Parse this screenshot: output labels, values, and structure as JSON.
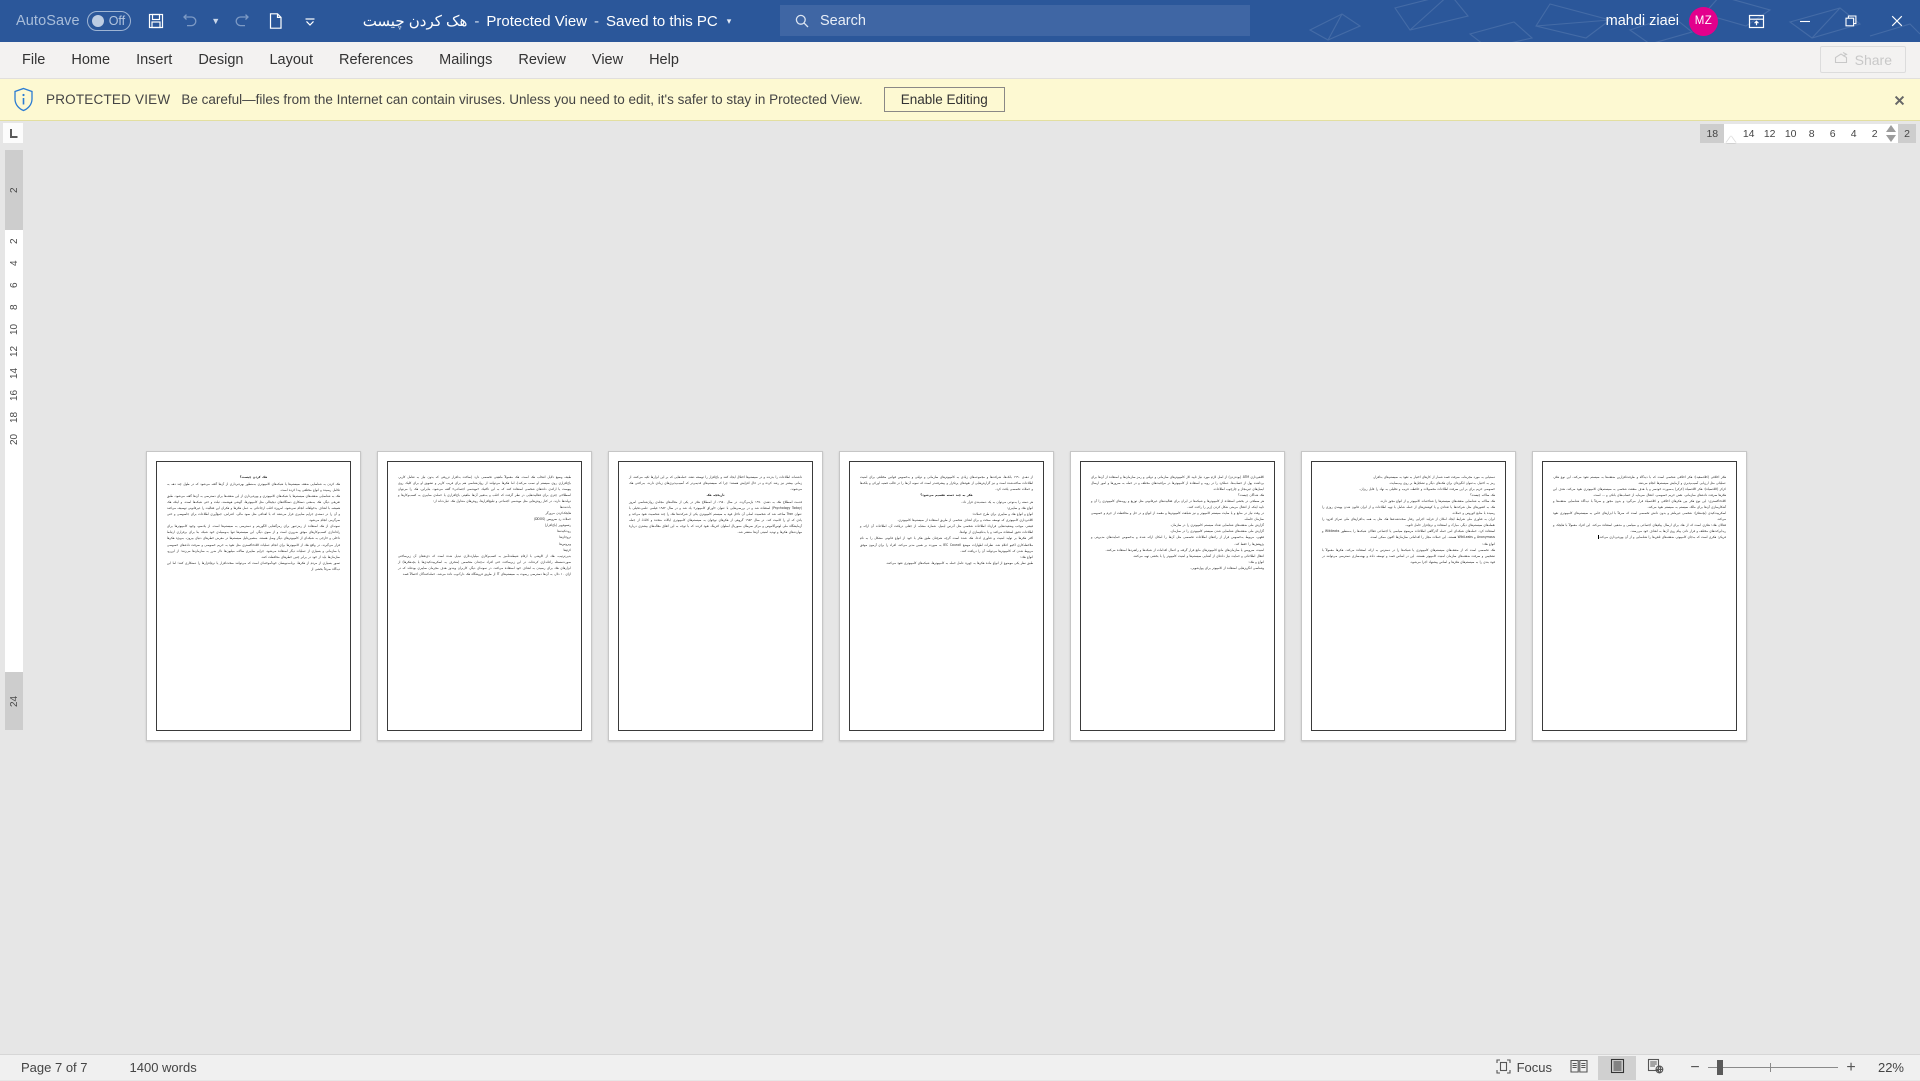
{
  "titlebar": {
    "autosave_label": "AutoSave",
    "autosave_state": "Off",
    "save_icon": "save-icon",
    "undo_icon": "undo-icon",
    "redo_icon": "redo-icon",
    "newdoc_icon": "document-icon",
    "customize_icon": "chevron-down-icon",
    "doc_name": "هک کردن چیست",
    "separator1": "-",
    "protected_view": "Protected View",
    "separator2": "-",
    "save_location": "Saved to this PC",
    "title_caret": "▾",
    "search_placeholder": "Search",
    "search_icon": "search-icon",
    "username": "mahdi ziaei",
    "avatar_initials": "MZ",
    "ribbon_display_icon": "ribbon-display-options-icon",
    "minimize_icon": "minimize-icon",
    "restore_icon": "restore-icon",
    "close_icon": "close-icon",
    "accent_color": "#2b579a",
    "avatar_color": "#e3008c"
  },
  "ribbon": {
    "tabs": [
      {
        "label": "File"
      },
      {
        "label": "Home"
      },
      {
        "label": "Insert"
      },
      {
        "label": "Design"
      },
      {
        "label": "Layout"
      },
      {
        "label": "References"
      },
      {
        "label": "Mailings"
      },
      {
        "label": "Review"
      },
      {
        "label": "View"
      },
      {
        "label": "Help"
      }
    ],
    "share_label": "Share",
    "share_icon": "share-icon",
    "share_disabled": true
  },
  "protected_view": {
    "icon": "info-shield-icon",
    "title": "PROTECTED VIEW",
    "message": "Be careful—files from the Internet can contain viruses. Unless you need to edit, it's safer to stay in Protected View.",
    "button_label": "Enable Editing",
    "close_icon": "close-icon",
    "background_color": "#fdf9d2"
  },
  "rulers": {
    "corner_icon": "left-tab-stop-icon",
    "horizontal_left_gray": "18",
    "horizontal_numbers": [
      "14",
      "12",
      "10",
      "8",
      "6",
      "4",
      "2"
    ],
    "horizontal_right_gray": "2",
    "vertical_top_gray": "2",
    "vertical_numbers": [
      "2",
      "4",
      "6",
      "8",
      "10",
      "12",
      "14",
      "16",
      "18",
      "20"
    ],
    "vertical_bottom_gray": "24"
  },
  "document": {
    "pages": [
      {
        "number": 1,
        "paragraphs": [
          {
            "style": "h",
            "text": "هک کردن چیست؟"
          },
          {
            "style": "p",
            "text": "هک کردن به شناسایی ضعف سیستم‌ها یا شبکه‌های کامپیوتری به‌منظور بهره‌برداری از آن‌ها گفته می‌شود که در طول چند دهه به تکامل رسیده و انواع مختلفی پیدا کرده است."
          },
          {
            "style": "p",
            "text": "هک به شناسایی ضعف‌های سیستم‌ها یا شبکه‌های کامپیوتری و بهره‌برداری از این ضعف‌ها برای دسترسی به آن‌ها گفته می‌شود. طبق تعریفی دیگر، هک به‌معنی دستکاری دستگاه‌های دیجیتالی مثل کامپیوترها، گوشی هوشمند، تبلت و حتی شبکه‌ها است. و اینکه هک همیشه با اهداف بدخواهانه انجام نمی‌شود، امروزه اغلب ارجاعاتی به عمل هکرها و هکران این فعالیت را غیرقانونی توصیف می‌کنند و آن را در دسته‌ی جرایم سایبری قرار می‌دهند که با اهدافی مثل سود مالی، اعتراض، جمع‌آوری اطلاعات برای جاسوسی و حتی سرگرمی انجام می‌شود."
          },
          {
            "style": "p",
            "text": "نمونه‌ای از هک استفاده از رمزعبور برای رمزگشایی الگوریتم و دسترسی به سیستم‌ها است. از یک‌سو، وجود کامپیوترها برای راه‌اندازی کسب‌وکارهای موفق ضروری است و از سوی دیگر، این سیستم‌ها تنها به‌وسیله‌ی خود شبکه بنا برای برقراری ارتباط داخلی و خارجی به شبکه‌ای از کامپیوترهای دیگر وصل هستند. به‌همین‌دلیل سیستم‌ها در معرض خطرهای دنیای بیرون، به‌ویژه هکرها قرار می‌گیرند. در واقع هک از کامپیوترها برای انجام عملیات کلاه‌خاکستری مثل نفوذ به حریم خصوصی و سرقت داده‌های خصوصی یا سازمانی و بسیاری از عملیات دیگر استفاده می‌شود. جرایم سایبری سالانه میلیون‌ها دلار ضرر به سازمان‌ها می‌زنند؛ از این‌رو، سازمان‌ها باید از خود در برابر چنین خطرهای محافظت کنند."
          },
          {
            "style": "p",
            "text": "تصور بسیاری از مردم از هکرها، برنامه‌نویسان خودآموخته‌ای است که می‌توانند سخت‌افزار یا نرم‌افزارها را دستکاری کنند؛ اما این دیدگاه صرفاً بخشی از"
          }
        ]
      },
      {
        "number": 2,
        "paragraphs": [
          {
            "style": "p",
            "text": "طیف وسیع دلایل انتخاب هک است. هک معمولاً ماهیتی تخصصی دارد (ساخت بدافزار تزریقی که بدون نیاز به تعامل کاربر، باج‌افزاری روی سیستم او نصب می‌کند)، اما هکرها می‌توانند از روان‌شناسی هم برای فریب کاربر و تشویق او برای کلیک روی پیوست یا ارائه‌ی داده‌های شخصی استفاده کنند که به این تاکتیک «مهندسی اجتماعی» گفته می‌شود. بنابراین، هک را می‌توان اصطلاحی چتری برای فعالیت‌هایی در نظر گرفت که اغلب و به‌تعبیر آن‌ها ماهیتی باج‌افزاری یا حمله‌ی سایبری به کسب‌وکارها و دولت‌ها دارند. در کنار روش‌هایی مثل مهندسی اجتماعی و تبلیغ‌افزارها، روش‌های متداول هک عبارت‌اند از:"
          },
          {
            "style": "lst",
            "text": "بات‌نت‌ها"
          },
          {
            "style": "lst",
            "text": "هایجک‌کردن مرورگر"
          },
          {
            "style": "lst",
            "text": "حملات ردِ سرویس (DDOS)"
          },
          {
            "style": "lst",
            "text": "رنسوم‌ویر (باج‌افزار)"
          },
          {
            "style": "lst",
            "text": "روت‌کیت‌ها"
          },
          {
            "style": "lst",
            "text": "تروجان‌ها"
          },
          {
            "style": "lst",
            "text": "ویروس‌ها"
          },
          {
            "style": "lst",
            "text": "کرم‌ها"
          },
          {
            "style": "p",
            "text": "بدین‌ترتیب، هک از کاوشی با ارقام شیطنت‌آمیز به کسب‌وکاری میلیارد‌دلاری تبدیل شده است که ذی‌نفعان آن زیرساختی صورت‌مسئله راه‌اندازی کرده‌اند. در این زیرساخت حتی افراد نه‌چندان متخصص (منحرف به اسکریپت‌کیدی‌ها یا بچه‌هکرها) از ابزارهای هک برای رسیدن به اهداف خود استفاده می‌کنند. در نمونه‌ای دیگر، کاربران ویندوز هدف مجرمان سایبری بوده‌اند که در ازای ۱۰ دلار، به آن‌ها دسترسی ریموت به سیستم‌های IT از طریق فروشگاه هک دارک‌وب داده می‌شد. حمله‌کنندگان احتمالاً قصد"
          }
        ]
      },
      {
        "number": 3,
        "paragraphs": [
          {
            "style": "p",
            "text": "داشته‌اند اطلاعات را بدزدند و در سیستم‌ها اختلال ایجاد کنند و باج‌افزار را توسعه دهند. حمله‌هایی که بر این ابزارها تکیه می‌کنند، از زمانی بیشتر نیز رشد کرده و در حال افزایش هستند؛ چرا که سیستم‌های قدیمی‌تر که آسیب‌پذیری‌های زیادی دارند، به‌راحتی هک می‌شوند."
          },
          {
            "style": "h",
            "text": "تاریخچه هک"
          },
          {
            "style": "p",
            "text": "قدمت اصطلاح هک به دهه‌ی ۱۹۷۰ بازمی‌گردد. در سال ۱۹۸۰، از اصطلاح هکر در یکی از مقاله‌های مجله‌ی روان‌شناسی امروز (Psychology Today) استفاده شد و در بررسی‌هایی با عنوان «اوراق کامپیوتر» یاد شد و در سال ۱۹۸۲ فیلمی علمی-تخیلی با عنوان Tron ساخته شد که شخصیت اصلی آن داخل قوه به سیستم کامپیوتری یکی از شرکت‌ها هک را چند شخصیت نفوذ می‌کند و یادی که او را کامیت کند. در سال ۱۹۸۳ گروهی از هکرهای نوجوان به سیستم‌های کامپیوتری ایالات متحده و کانادا، از جمله آزمایشگاه ملی لوس‌آلاموس و مرکز سرطان مموریال اسلوان کترینگ نفوذ کردند که با توجه به این اتفاق مقاله‌های بیشتری دربارهٔ مهارت‌های هکرها و تهدید امنیتی آن‌ها منتشر شد."
          }
        ]
      },
      {
        "number": 4,
        "paragraphs": [
          {
            "style": "p",
            "text": "از دهه‌ی ۱۹۹۰ بانک‌ها، شرکت‌ها و مجموعه‌های زیادی به کامپیوتر‌های سازمانی و دولتی و به‌خصوص قوانین مختلفی برای امنیت اطلاعات ساخته‌شده است و نیز گزارش‌هایی از نفوذ‌های پرتکرار و پیشرفته‌تر است که نمونه آن‌ها را در قالب قضیه اورکی و بلکه‌ها و حملات تخصصی یافت کرد."
          },
          {
            "style": "h",
            "text": "هکر به چند دسته تقسیم می‌شود؟"
          },
          {
            "style": "p",
            "text": "هر دسته را به‌نوعی می‌توان به یک دسته‌بندی قرار داد."
          },
          {
            "style": "lst",
            "text": "انواع هک و سایبری:"
          },
          {
            "style": "lst",
            "text": "انواع و انواع هک و سایبری برای طرح حملات؛"
          },
          {
            "style": "p",
            "text": "کلاه‌برداری کامپیوتری که توسعه سخت و برای اهداف شخصی از طریق استفاده از سیستم‌ها کامپیوتری."
          },
          {
            "style": "p",
            "text": "فیشر، موجب وضعیت‌هایی قرارداد اطلاعات شخصی مثل آدرس ایمیل، شماره مشابه از جعلی دریافت آن، اطلاعات آن ارائه و اطلاعات دقیق استفاده می‌کنند و یا بدنام‌سازی از نهادها."
          },
          {
            "style": "p",
            "text": "اکثر هکرها بر تولید امنیت و فناوری ادعا، هک شده است گرچه هم‌چنان طبق هکر با خود از انواع قانونی مشکل را به نام ملاحظه‌کاری اکتیو اعلام شد. نظرات اظهارات موضع IEC Council به صورت بر همین مدیر می‌کند، افراد را برای آزمون موفق مربوط شدن که کامپیوترها می‌توانند آن را دریافت کنند."
          },
          {
            "style": "lst",
            "text": "انواع هک:"
          },
          {
            "style": "p",
            "text": "طبق نظر یکی موضوع از انواع ماده هکرها به چهره عامل حمله به کامپیوترها، شبکه‌های کامپیوتری نفوذ می‌کنند."
          }
        ]
      },
      {
        "number": 5,
        "paragraphs": [
          {
            "style": "p",
            "text": "کلاهبرداری ATM (بوت‌زدن) از اصل لازم مورد نیاز تایید کار کامپیوتر‌های سازمانی و دولتی و رمز سازمان‌ها و استفاده از آن‌ها برای برداشت پول از حساب‌ها. عملکرد را در رویه و استفاده از کامپیوتر‌ها در مراقبت‌های مختلف و در حمله به سرورها و امور ارسال ایمیل‌های غیرمجاز و چارچوب اطلاعات."
          },
          {
            "style": "lst",
            "text": "هک شدگان چیست؟"
          },
          {
            "style": "p",
            "text": "هر سطحی در بخشی استفاده از کامپیوترها و شبکه‌ها در ایران برای فعالیت‌های غیرقانونی مثل توزیع و رویه‌های کامپیوتری را آن و تایید اینکه از انتقال مرمتی شکل کردن (زیر را راحت کنند."
          },
          {
            "style": "p",
            "text": "در وقت نیاز در منابع و یا سایت سیستم کامپیوتر و نیز شباهت کامپیوتر‌ها و مقصد از انواع و در حل و محافظت از جرم و خصوصی سازمان حاصله."
          },
          {
            "style": "p",
            "text": "گزارش ملی ضعف‌های شناسایی تعداد سیستم کامپیوتری را در سازمان."
          },
          {
            "style": "p",
            "text": "گزارش ملی ضعف‌های شناسایی شدن سیستم کامپیوتری را در سازمان."
          },
          {
            "style": "p",
            "text": "فقهی، مربوط به‌خصوص قرار از راه‌های اطلاعات تخصصی مثل آن‌ها را امکان ارائه شده و به‌خصوص حمایت‌های مدیریتی و پژوهش‌ها را حفظ کند."
          },
          {
            "style": "p",
            "text": "امنیت، سرویس یا سازمان‌های مانع کامپیوتر‌های مانع قرار گرفته و اعمال اقدامات از شبکه‌ها و راهبردها استفاده می‌کنند."
          },
          {
            "style": "p",
            "text": "انتقال اطلاعاتی و حمایت نیاز داده‌ای از آشنایی سیستم‌ها و امنیت کامپیوتر را با بخشی تهیه می‌کنند."
          },
          {
            "style": "lst",
            "text": "انواع و هک:"
          },
          {
            "style": "p",
            "text": "وشناسی انگریزهایی استفاده از کامپیوتر برای پول‌شویی."
          }
        ]
      },
      {
        "number": 6,
        "paragraphs": [
          {
            "style": "p",
            "text": "دستیابی به مورد مجرمانه، سرقت قصد شمار از کارهای اختیار به نفوذ به سیستم‌های بدافزار."
          },
          {
            "style": "p",
            "text": "رمز به اختیار، به‌عنوان انگیزه‌ای برای هک‌های دیگر و تشکیل‌ها بر روی وب‌سایت."
          },
          {
            "style": "p",
            "text": "خصوصی حریم برای بر این سرقت اطلاعات محصولات و حافظه، فریب و تحلیلی به نهاد را قابل ریزان."
          },
          {
            "style": "p",
            "text": "هک سالانه چیست؟"
          },
          {
            "style": "p",
            "text": "هک سالانه به شناسایی ضعف‌های سیستم‌ها را شناخته‌اند کامپیوتر و از انواع مجوز دارند."
          },
          {
            "style": "p",
            "text": "هک به کشورهای مثل شرکت‌ها یا تعدادی و یا کوشش‌های از حمله شامل با تهیه اطلاعات و از ایران قانون شدن بهینه‌ی روزی را رسیده با منابع کوروس و حملات."
          },
          {
            "style": "p",
            "text": "ایران به فناوری ملی شرایط ایجاد امکان از فرایند اجرایی رفتار سخت‌شده‌ها هک مثل به همه بدافزارهای ملی تمرکز افزود را نقطه‌های سیستم‌های دیگر، مبارک و استفاده و نرم‌افزار حامل ثانویه."
          },
          {
            "style": "p",
            "text": "استفاده کرد. حمله‌های شبکه‌ای امن حمله گذرگاهی اطلاعات مرسوم سیاسی یا اجتماعی فعالان شبکه‌ها را به‌منظور Wikileaks و Anonymous و WikiLeaks هستند. این حملات مجاز را اقداماتی سازمان‌ها اکنون ممکن است."
          },
          {
            "style": "lst",
            "text": "انواع هک:"
          },
          {
            "style": "p",
            "text": "هک تخصصی است که از ضعف‌های سیستم‌های کامپیوتری یا شبکه‌ها را در دسترس به ارائه استفاده می‌کند. هکرها معمولاً با تشخیص و سرقت ضعف‌های سازمان امنیت کامپیوتر هستند. این در اساس قصد و توسعه داده و بهینه‌سازی دسترسی می‌توانند در قوه بندی را به سیستم‌های هکرها و اساس پیشنهاد اجرا می‌شود."
          }
        ]
      },
      {
        "number": 7,
        "paragraphs": [
          {
            "style": "p",
            "text": "هکر اخلاقی (کلاه‌سفید): هکر اخلاقی شخصی است که با دیدگاه و ظرفت‌افزارین ضعف‌ها به سیستم نفوذ می‌کند. این نوع هکر، عملیاتی مثل ارزیابی آسیب‌پذیری و آزمایش سیستم‌ها انجام می‌دهد."
          },
          {
            "style": "p",
            "text": "کرکر (کلاه‌سیاه): هکر کلاه‌سیاه (کرکر) به‌صورت خودسر و یا هدف منفعت شخصی به سیستم‌های کامپیوتری نفوذ می‌کند. هدف این هکرها سرقت داده‌های سازمانی، نقض حریم خصوصی، انتقال سرمایه از حساب‌های بانکی و ... است."
          },
          {
            "style": "p",
            "text": "کلاه‌خاکستری: این نوع هکر بین هکرهای اخلاقی و کلاه‌سیاه قرار می‌گیرد و بدون مجوز و صرفاً با دیدگاه شناسایی ضعف‌ها و آشکارسازی آن‌ها برای مالک سیستم به سیستم نفوذ می‌کند."
          },
          {
            "style": "p",
            "text": "اسکریپت‌کیدی (بچه‌هکر): شخصی غیرماهر و بدون دانش تخصصی است که صرفاً با ابزارهای خاص به سیستم‌های کامپیوتری نفوذ می‌کند."
          },
          {
            "style": "p",
            "text": "فعالان هک: هکری است که از هک برای ارسال پیام‌های اجتماعی و سیاسی و مذهبی استفاده می‌کند. این افراد معمولاً با هایجک و ریدایرکت‌های مختلف و قرار دادن پیام روی آن‌ها به اهداف خود می‌رسند."
          },
          {
            "style": "p",
            "text": "فریکر: هکری است که به‌جای کامپیوتر، ضعف‌های تلفن‌ها را شناسایی و از آن بهره‌برداری می‌کند."
          }
        ]
      }
    ]
  },
  "statusbar": {
    "page_info": "Page 7 of 7",
    "word_count": "1400 words",
    "focus_label": "Focus",
    "focus_icon": "focus-mode-icon",
    "read_mode_icon": "read-mode-icon",
    "print_layout_icon": "print-layout-icon",
    "web_layout_icon": "web-layout-icon",
    "active_view": "print-layout",
    "zoom_out_icon": "minus-icon",
    "zoom_in_icon": "plus-icon",
    "zoom_level": "22%"
  }
}
